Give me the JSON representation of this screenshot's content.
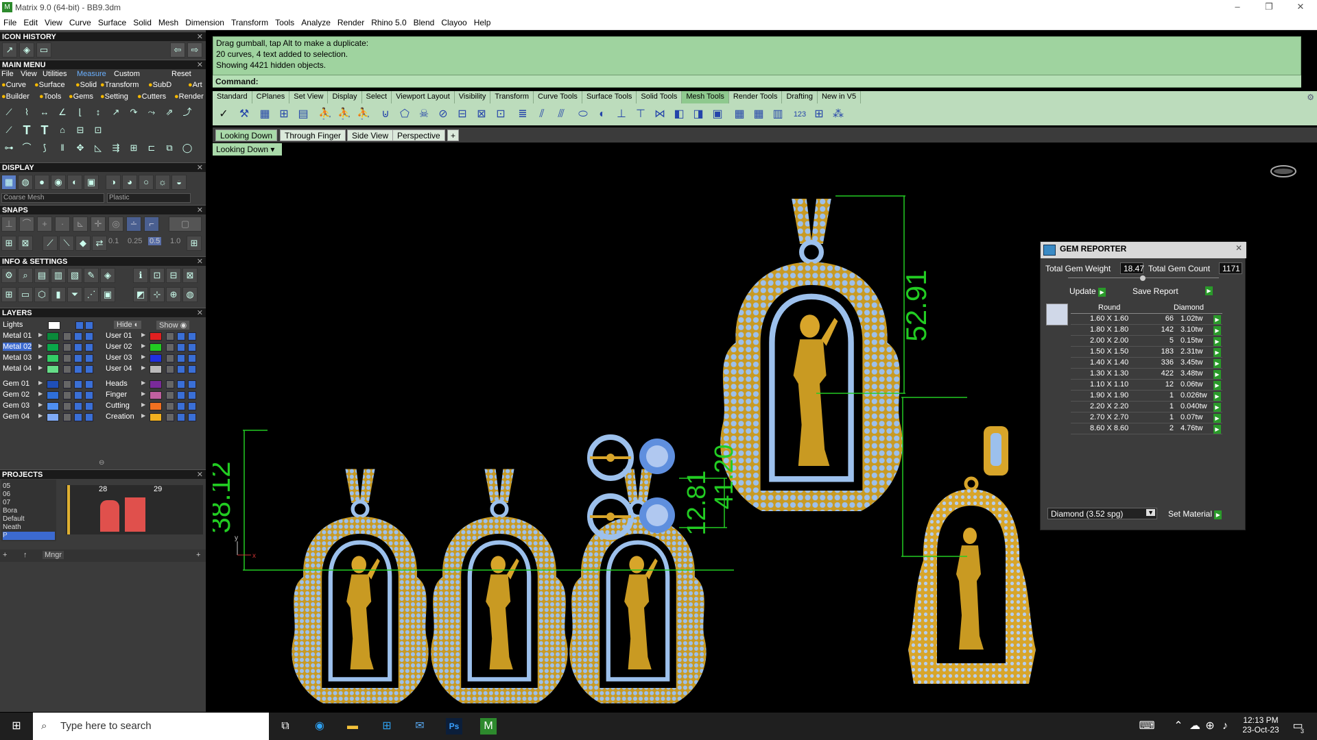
{
  "window": {
    "title": "Matrix 9.0 (64-bit) - BB9.3dm",
    "minimize": "–",
    "maximize": "❐",
    "close": "✕"
  },
  "menu": [
    "File",
    "Edit",
    "View",
    "Curve",
    "Surface",
    "Solid",
    "Mesh",
    "Dimension",
    "Transform",
    "Tools",
    "Analyze",
    "Render",
    "Rhino 5.0",
    "Blend",
    "Clayoo",
    "Help"
  ],
  "left": {
    "icon_history": "ICON HISTORY",
    "main_menu": "MAIN MENU",
    "main_menu_items": [
      "File",
      "View",
      "Utilities",
      "Measure",
      "Custom",
      "Reset"
    ],
    "cat_row1": [
      "Curve",
      "Surface",
      "Solid",
      "Transform",
      "SubD",
      "Art"
    ],
    "cat_row2": [
      "Builder",
      "Tools",
      "Gems",
      "Setting",
      "Cutters",
      "Render"
    ],
    "display": "DISPLAY",
    "display_mesh": "Coarse Mesh",
    "display_material": "Plastic",
    "snaps": "SNAPS",
    "snap_values": [
      "0.1",
      "0.25",
      "0.5",
      "1.0"
    ],
    "info": "INFO & SETTINGS",
    "layers": "LAYERS",
    "layer_lights": "Lights",
    "hide": "Hide",
    "show": "Show",
    "layers_left": [
      "Metal 01",
      "Metal 02",
      "Metal 03",
      "Metal 04",
      "Gem 01",
      "Gem 02",
      "Gem 03",
      "Gem 04"
    ],
    "layers_right": [
      "User 01",
      "User 02",
      "User 03",
      "User 04",
      "Heads",
      "Finger",
      "Cutting",
      "Creation"
    ],
    "projects": "PROJECTS",
    "project_list": [
      "05",
      "06",
      "07",
      "Bora",
      "Default",
      "Neath",
      "P"
    ],
    "project_thumbs": [
      "28",
      "29"
    ],
    "mngr": "Mngr"
  },
  "command": {
    "lines": [
      "Drag gumball, tap Alt to make a duplicate:",
      "20 curves, 4 text added to selection.",
      "Showing 4421 hidden objects."
    ],
    "prompt": "Command:"
  },
  "tool_tabs": [
    "Standard",
    "CPlanes",
    "Set View",
    "Display",
    "Select",
    "Viewport Layout",
    "Visibility",
    "Transform",
    "Curve Tools",
    "Surface Tools",
    "Solid Tools",
    "Mesh Tools",
    "Render Tools",
    "Drafting",
    "New in V5"
  ],
  "tool_tab_active": "Mesh Tools",
  "viewport_tabs": [
    "Looking Down",
    "Through Finger",
    "Side View",
    "Perspective"
  ],
  "viewport_active": "Looking Down",
  "viewport_label": "Looking Down",
  "dimensions": {
    "d1": "52.91",
    "d2": "38.12",
    "d3": "12.81",
    "d4": "41.20"
  },
  "axis": {
    "x": "x",
    "y": "y"
  },
  "gem_reporter": {
    "title": "GEM REPORTER",
    "weight_label": "Total Gem Weight",
    "weight": "18.47",
    "count_label": "Total Gem Count",
    "count": "1171",
    "update": "Update",
    "save": "Save Report",
    "col_shape": "Round",
    "col_material": "Diamond",
    "rows": [
      {
        "size": "1.60 X 1.60",
        "qty": "66",
        "wt": "1.02tw"
      },
      {
        "size": "1.80 X 1.80",
        "qty": "142",
        "wt": "3.10tw"
      },
      {
        "size": "2.00 X 2.00",
        "qty": "5",
        "wt": "0.15tw"
      },
      {
        "size": "1.50 X 1.50",
        "qty": "183",
        "wt": "2.31tw"
      },
      {
        "size": "1.40 X 1.40",
        "qty": "336",
        "wt": "3.45tw"
      },
      {
        "size": "1.30 X 1.30",
        "qty": "422",
        "wt": "3.48tw"
      },
      {
        "size": "1.10 X 1.10",
        "qty": "12",
        "wt": "0.06tw"
      },
      {
        "size": "1.90 X 1.90",
        "qty": "1",
        "wt": "0.026tw"
      },
      {
        "size": "2.20 X 2.20",
        "qty": "1",
        "wt": "0.040tw"
      },
      {
        "size": "2.70 X 2.70",
        "qty": "1",
        "wt": "0.07tw"
      },
      {
        "size": "8.60 X 8.60",
        "qty": "2",
        "wt": "4.76tw"
      }
    ],
    "material_select": "Diamond    (3.52 spg)",
    "set_material": "Set Material"
  },
  "taskbar": {
    "search_placeholder": "Type here to search",
    "time": "12:13 PM",
    "date": "23-Oct-23",
    "notif_count": "3"
  },
  "colors": {
    "accent_green": "#22cc22",
    "panel_bg": "#3b3b3b",
    "command_bg": "#9fd39f",
    "gold": "#d8a52a",
    "gem_blue": "#8fb3e6"
  }
}
